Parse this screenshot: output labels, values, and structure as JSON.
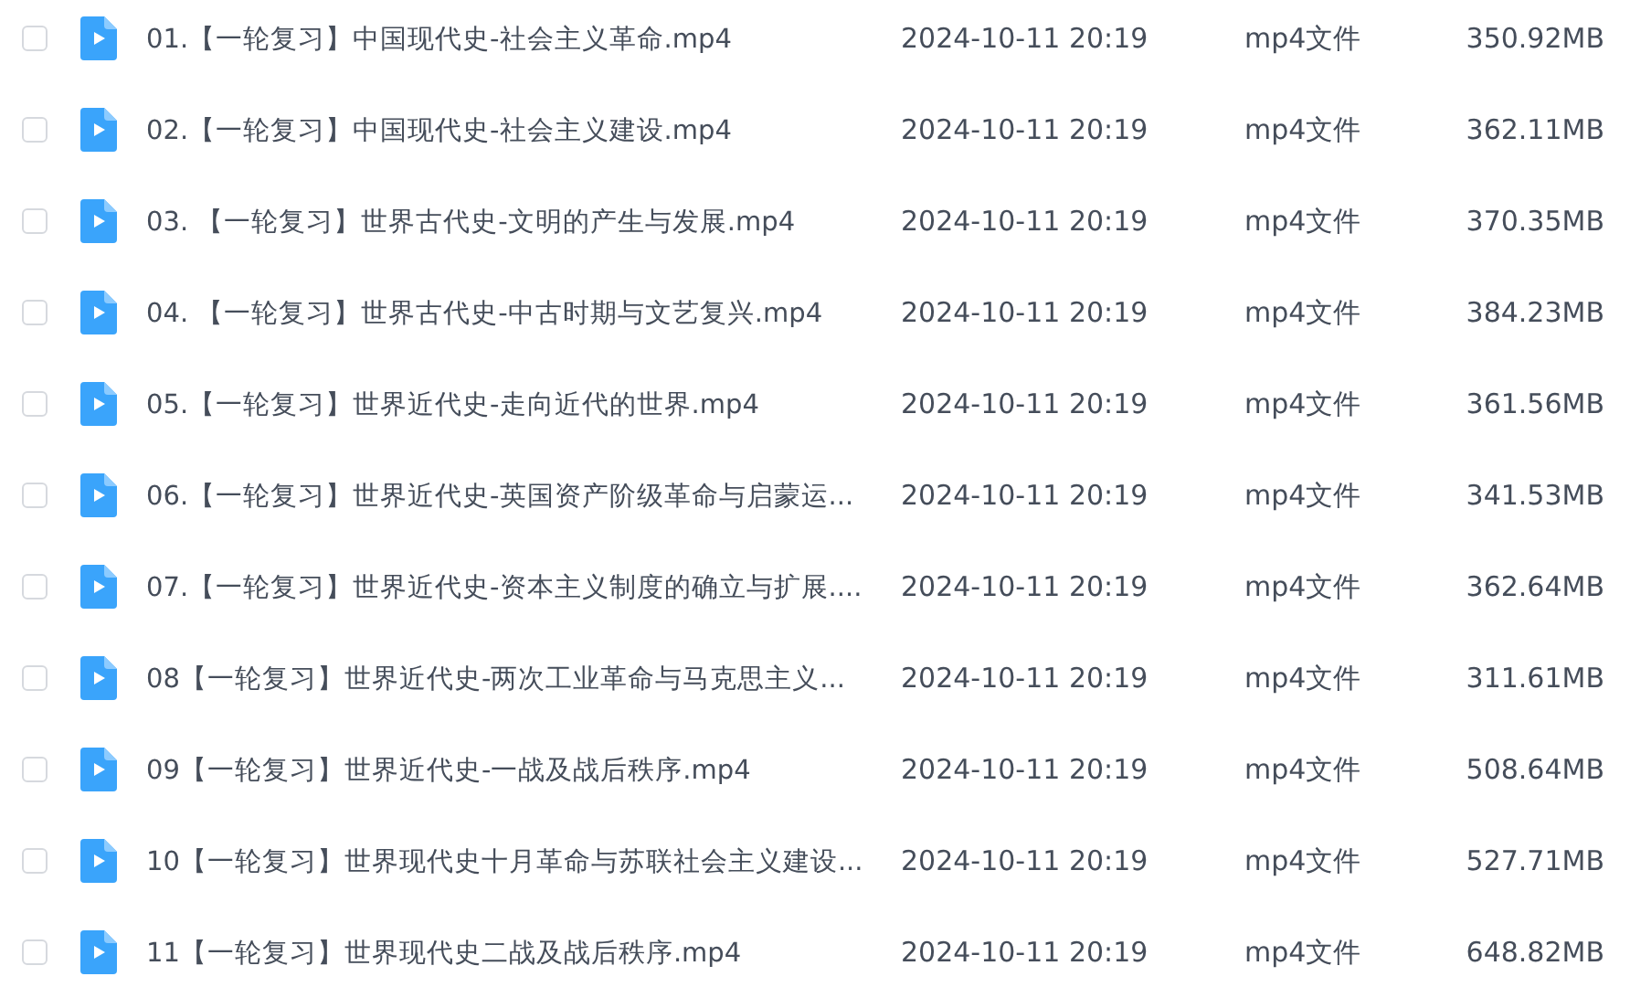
{
  "files": [
    {
      "name": "01.【一轮复习】中国现代史-社会主义革命.mp4",
      "modified": "2024-10-11 20:19",
      "type": "mp4文件",
      "size": "350.92MB",
      "checked": false
    },
    {
      "name": "02.【一轮复习】中国现代史-社会主义建设.mp4",
      "modified": "2024-10-11 20:19",
      "type": "mp4文件",
      "size": "362.11MB",
      "checked": false
    },
    {
      "name": "03. 【一轮复习】世界古代史-文明的产生与发展.mp4",
      "modified": "2024-10-11 20:19",
      "type": "mp4文件",
      "size": "370.35MB",
      "checked": false
    },
    {
      "name": "04. 【一轮复习】世界古代史-中古时期与文艺复兴.mp4",
      "modified": "2024-10-11 20:19",
      "type": "mp4文件",
      "size": "384.23MB",
      "checked": false
    },
    {
      "name": "05.【一轮复习】世界近代史-走向近代的世界.mp4",
      "modified": "2024-10-11 20:19",
      "type": "mp4文件",
      "size": "361.56MB",
      "checked": false
    },
    {
      "name": "06.【一轮复习】世界近代史-英国资产阶级革命与启蒙运...",
      "modified": "2024-10-11 20:19",
      "type": "mp4文件",
      "size": "341.53MB",
      "checked": false
    },
    {
      "name": "07.【一轮复习】世界近代史-资本主义制度的确立与扩展....",
      "modified": "2024-10-11 20:19",
      "type": "mp4文件",
      "size": "362.64MB",
      "checked": false
    },
    {
      "name": "08【一轮复习】世界近代史-两次工业革命与马克思主义...",
      "modified": "2024-10-11 20:19",
      "type": "mp4文件",
      "size": "311.61MB",
      "checked": false
    },
    {
      "name": "09【一轮复习】世界近代史-一战及战后秩序.mp4",
      "modified": "2024-10-11 20:19",
      "type": "mp4文件",
      "size": "508.64MB",
      "checked": false
    },
    {
      "name": "10【一轮复习】世界现代史十月革命与苏联社会主义建设...",
      "modified": "2024-10-11 20:19",
      "type": "mp4文件",
      "size": "527.71MB",
      "checked": false
    },
    {
      "name": "11【一轮复习】世界现代史二战及战后秩序.mp4",
      "modified": "2024-10-11 20:19",
      "type": "mp4文件",
      "size": "648.82MB",
      "checked": false
    }
  ]
}
